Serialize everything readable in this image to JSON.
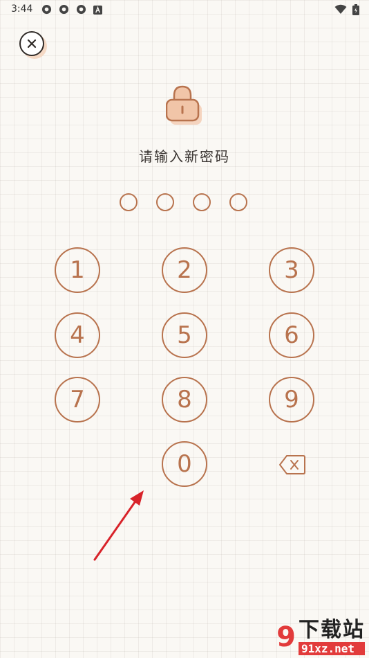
{
  "status_bar": {
    "time": "3:44",
    "colors": {
      "icon": "#444444"
    }
  },
  "header": {
    "close_icon": "close-icon"
  },
  "lock": {
    "icon": "lock-icon",
    "color": "#e8a882"
  },
  "title": "请输入新密码",
  "pin": {
    "length": 4,
    "entered": 0
  },
  "keypad": {
    "keys": [
      {
        "label": "1"
      },
      {
        "label": "2"
      },
      {
        "label": "3"
      },
      {
        "label": "4"
      },
      {
        "label": "5"
      },
      {
        "label": "6"
      },
      {
        "label": "7"
      },
      {
        "label": "8"
      },
      {
        "label": "9"
      },
      {
        "label": "0"
      }
    ],
    "delete_icon": "backspace-icon",
    "accent": "#b8734e"
  },
  "watermark": {
    "brand": "下载站",
    "url": "91xz.net",
    "logo": "9"
  }
}
